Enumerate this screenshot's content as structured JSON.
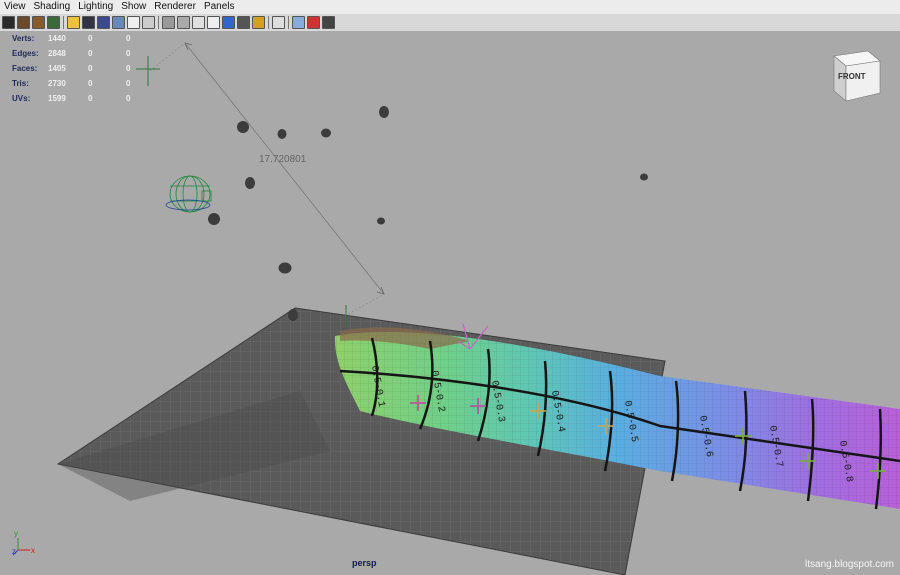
{
  "menu": [
    "View",
    "Shading",
    "Lighting",
    "Show",
    "Renderer",
    "Panels"
  ],
  "toolbar_icons": [
    "select-camera-icon",
    "camera-attributes-icon",
    "bookmark-icon",
    "image-plane-icon",
    "separator",
    "grid-icon",
    "film-gate-icon",
    "resolution-gate-icon",
    "gate-mask-icon",
    "field-chart-icon",
    "safe-action-icon",
    "separator",
    "wireframe-icon",
    "smooth-shade-icon",
    "shade-all-icon",
    "texture-icon",
    "lights-icon",
    "shadows-icon",
    "xray-icon",
    "separator",
    "isolate-select-icon",
    "separator",
    "xray-joints-icon",
    "xray-active-icon",
    "hud-icon"
  ],
  "hud": {
    "rows": [
      {
        "label": "Verts:",
        "v1": "1440",
        "v2": "0",
        "v3": "0"
      },
      {
        "label": "Edges:",
        "v1": "2848",
        "v2": "0",
        "v3": "0"
      },
      {
        "label": "Faces:",
        "v1": "1405",
        "v2": "0",
        "v3": "0"
      },
      {
        "label": "Tris:",
        "v1": "2730",
        "v2": "0",
        "v3": "0"
      },
      {
        "label": "UVs:",
        "v1": "1599",
        "v2": "0",
        "v3": "0"
      }
    ]
  },
  "distance_readout": "17.720801",
  "viewcube_label": "FRONT",
  "camera_name": "persp",
  "watermark": "ltsang.blogspot.com",
  "axis": {
    "x": "x",
    "y": "y",
    "z": "z"
  },
  "uv_labels": [
    "0.5-0.1",
    "0.5-0.2",
    "0.5-0.3",
    "0.5-0.4",
    "0.5-0.5",
    "0.5-0.6",
    "0.5-0.7",
    "0.5-0.8"
  ],
  "colors": {
    "viewport": "#a9a9a9",
    "menubar": "#ececec",
    "hud_label": "#1f2a5a",
    "hud_value": "#f0f0f0",
    "camera_label": "#101a55"
  }
}
